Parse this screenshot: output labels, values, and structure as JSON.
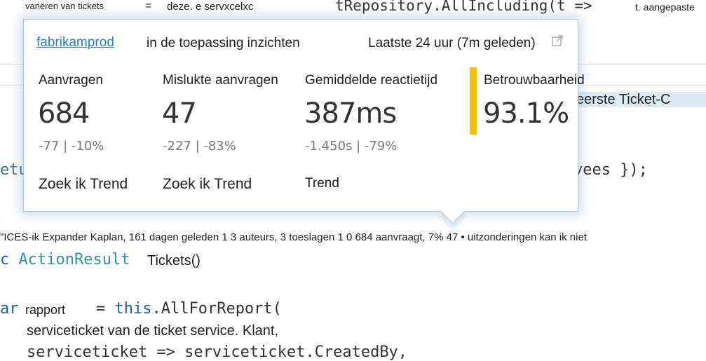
{
  "editor": {
    "top_left": "variëren van tickets",
    "top_eq": "=",
    "top_mid": "deze. e servxcelxc",
    "top_repo": "tRepository.AllIncluding(t =>",
    "top_right": "t. aangepaste",
    "right_ticket": "eerste Ticket-C",
    "right_yees": "yees });",
    "left_etu": "etu",
    "codelens": "\"ICES-ik Expander Kaplan, 161 dagen geleden 1 3 auteurs, 3 toeslagen 1 0 684 aanvraagt, 7% 47 • uitzonderingen kan ik niet",
    "action_prefix": "c",
    "action_type": "ActionResult",
    "action_name": "Tickets()",
    "var_kw": "ar",
    "rapport": "rapport",
    "this_eq": "=",
    "this_kw": "this",
    "this_rest": ".AllForReport(",
    "svc_line": "serviceticket van de ticket service. Klant,",
    "svc_line2": "serviceticket => serviceticket.CreatedBy,"
  },
  "popup": {
    "app_link": "fabrikamprod",
    "header_rest": "in de toepassing inzichten",
    "time_range": "Laatste 24 uur (7m geleden)",
    "popout_icon": "popout-icon",
    "metrics": [
      {
        "title": "Aanvragen",
        "value": "684",
        "delta": "-77 | -10%",
        "link": "Zoek ik Trend"
      },
      {
        "title": "Mislukte aanvragen",
        "value": "47",
        "delta": "-227 | -83%",
        "link": "Zoek ik Trend"
      },
      {
        "title": "Gemiddelde reactietijd",
        "value": "387ms",
        "delta": "-1.450s | -79%",
        "link": "Trend"
      },
      {
        "title": "Betrouwbaarheid",
        "value": "93.1%",
        "accent": "#f4c20d"
      }
    ]
  }
}
